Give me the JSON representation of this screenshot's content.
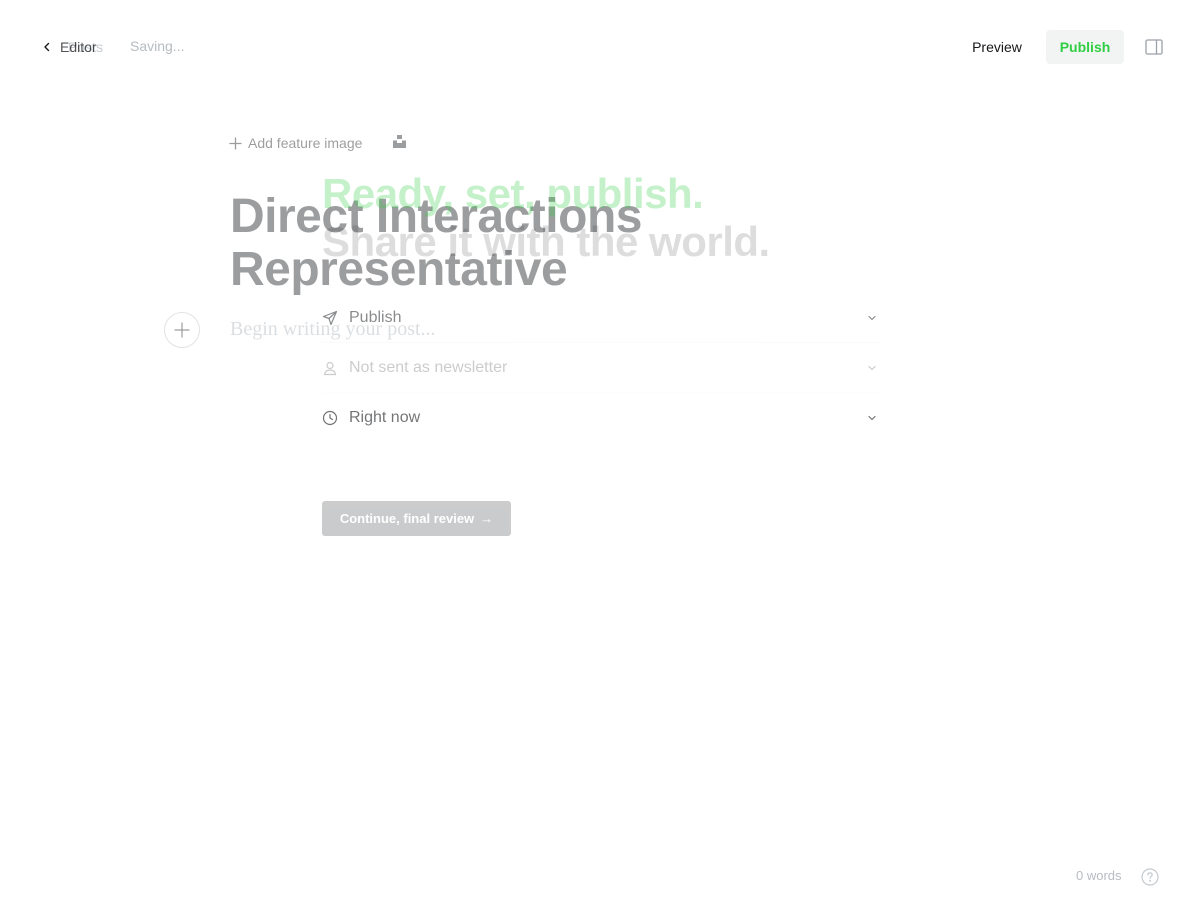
{
  "topbar": {
    "back_label_behind": "Posts",
    "back_label": "Editor",
    "status": "Saving...",
    "preview_label": "Preview",
    "publish_label": "Publish"
  },
  "editor": {
    "feature_image_label": "Add feature image",
    "title": "Direct Interactions Representative",
    "body_placeholder": "Begin writing your post..."
  },
  "publish_flow": {
    "headline_1": "Ready, set, publish.",
    "headline_2": "Share it with the world.",
    "options": [
      {
        "icon": "send-icon",
        "label": "Publish"
      },
      {
        "icon": "user-icon",
        "label": "Not sent as newsletter"
      },
      {
        "icon": "clock-icon",
        "label": "Right now"
      }
    ],
    "continue_label": "Continue, final review",
    "continue_arrow": "→"
  },
  "footer": {
    "word_count": "0 words"
  },
  "colors": {
    "accent": "#30cf43",
    "text": "#15171a",
    "muted": "#b7bcc1"
  }
}
